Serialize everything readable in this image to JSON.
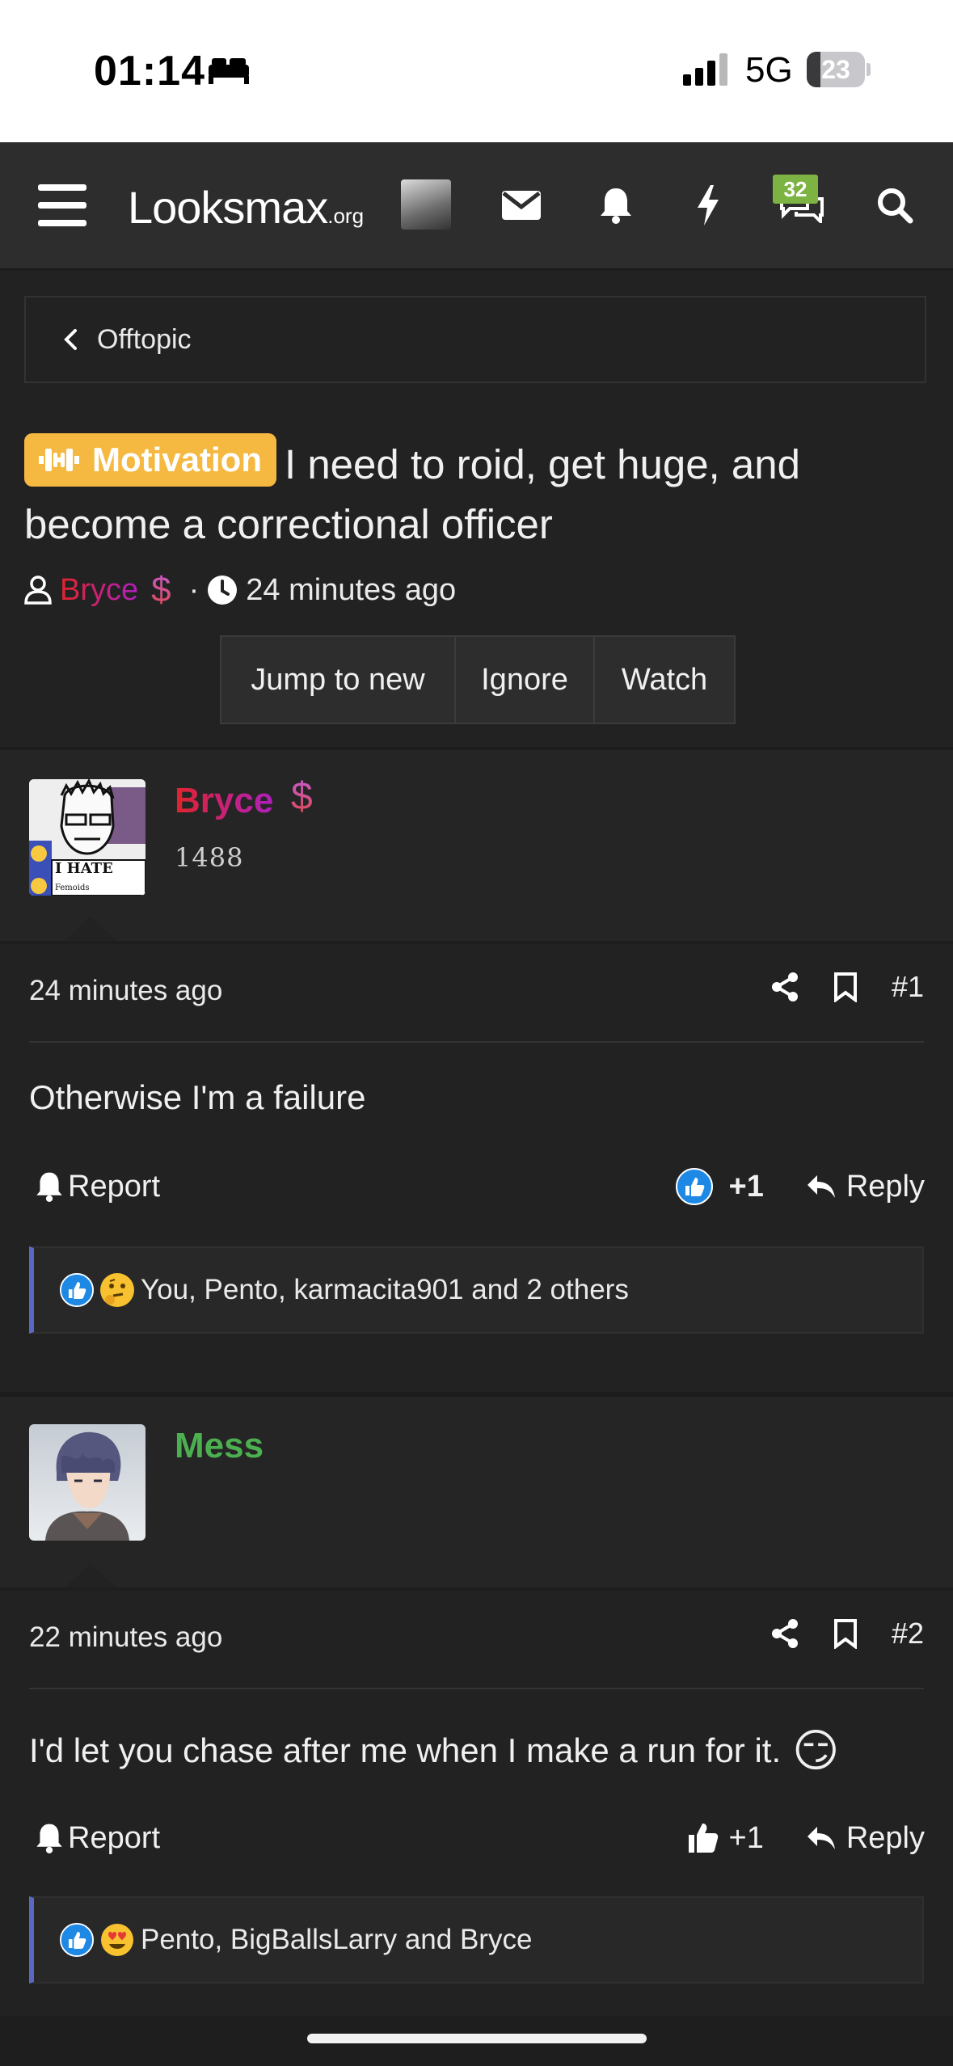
{
  "status_bar": {
    "time": "01:14",
    "network": "5G",
    "battery": "23",
    "battery_level": 0.23
  },
  "header": {
    "logo_main": "Looksmax",
    "logo_suffix": ".org",
    "conversations_badge": "32",
    "icons": [
      "menu-icon",
      "avatar",
      "mail-icon",
      "bell-icon",
      "bolt-icon",
      "conversations-icon",
      "search-icon"
    ]
  },
  "breadcrumb": {
    "label": "Offtopic"
  },
  "thread": {
    "prefix": "Motivation",
    "title": "I need to roid, get huge, and become a correctional officer",
    "author": "Bryce",
    "author_badge": "$",
    "separator": "·",
    "time": "24 minutes ago",
    "buttons": [
      "Jump to new",
      "Ignore",
      "Watch"
    ]
  },
  "posts": [
    {
      "author": "Bryce",
      "badge": "$",
      "user_title": "1488",
      "avatar_text": "I HATE",
      "avatar_subtext": "Femoids",
      "time": "24 minutes ago",
      "number": "#1",
      "body": "Otherwise I'm a failure",
      "report_label": "Report",
      "reaction_score": "+1",
      "reply_label": "Reply",
      "reactions_text": "You, Pento, karmacita901 and 2 others"
    },
    {
      "author": "Mess",
      "time": "22 minutes ago",
      "number": "#2",
      "body": "I'd let you chase after me when I make a run for it.",
      "body_emoji": "😏",
      "report_label": "Report",
      "reaction_score": "+1",
      "reply_label": "Reply",
      "reactions_text": "Pento, BigBallsLarry and Bryce"
    }
  ],
  "colors": {
    "background": "#222222",
    "header": "#2d2d2d",
    "prefix": "#f5b840",
    "mess_green": "#4caf50",
    "reaction_border": "#5a68c2",
    "badge_green": "#7cb342"
  }
}
